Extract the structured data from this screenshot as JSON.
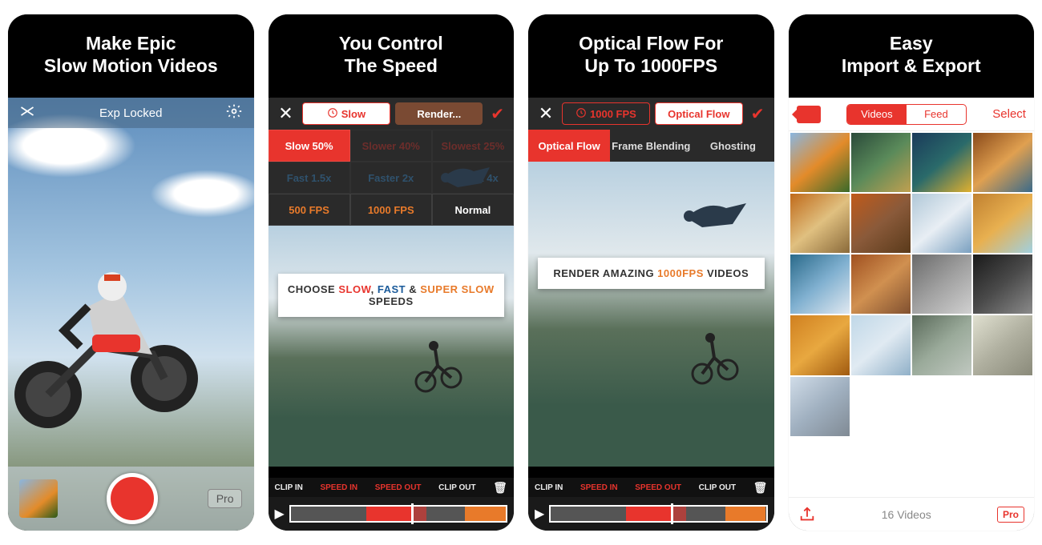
{
  "panels": [
    {
      "banner_l1": "Make Epic",
      "banner_l2": "Slow Motion Videos",
      "status_title": "Exp Locked",
      "pro_label": "Pro"
    },
    {
      "banner_l1": "You Control",
      "banner_l2": "The Speed",
      "seg_slow": "Slow",
      "seg_render": "Render...",
      "grid": {
        "r1": [
          "Slow 50%",
          "Slower 40%",
          "Slowest 25%"
        ],
        "r2": [
          "Fast 1.5x",
          "Faster 2x",
          "Fastest 4x"
        ],
        "r3": [
          "500 FPS",
          "1000 FPS",
          "Normal"
        ]
      },
      "overlay": {
        "pre": "CHOOSE ",
        "slow": "SLOW",
        "sep1": ", ",
        "fast": "FAST",
        "sep2": " & ",
        "super": "SUPER SLOW",
        "post": " SPEEDS"
      },
      "clip": {
        "in": "CLIP IN",
        "speed_in": "SPEED IN",
        "speed_out": "SPEED OUT",
        "out": "CLIP OUT"
      }
    },
    {
      "banner_l1": "Optical Flow For",
      "banner_l2": "Up To 1000FPS",
      "seg_fps": "1000 FPS",
      "seg_flow": "Optical Flow",
      "tabs": [
        "Optical Flow",
        "Frame Blending",
        "Ghosting"
      ],
      "overlay": {
        "pre": "RENDER AMAZING ",
        "fps": "1000FPS",
        "post": " VIDEOS"
      },
      "clip": {
        "in": "CLIP IN",
        "speed_in": "SPEED IN",
        "speed_out": "SPEED OUT",
        "out": "CLIP OUT"
      }
    },
    {
      "banner_l1": "Easy",
      "banner_l2": "Import & Export",
      "seg_videos": "Videos",
      "seg_feed": "Feed",
      "select": "Select",
      "count": "16 Videos",
      "pro": "Pro"
    }
  ]
}
